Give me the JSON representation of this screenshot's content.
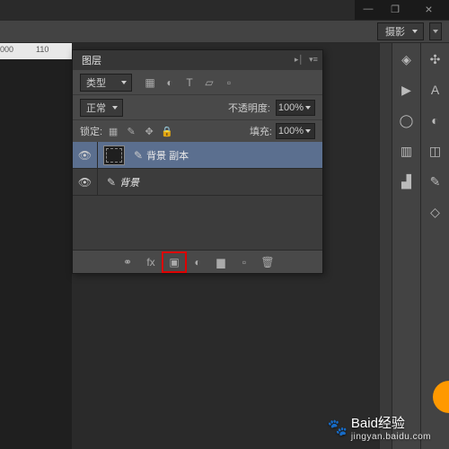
{
  "window": {
    "min": "—",
    "restore": "❐",
    "close": "×"
  },
  "workspace": {
    "selected": "摄影"
  },
  "ruler": {
    "mark1": "000",
    "mark2": "110"
  },
  "panel": {
    "title": "图层",
    "kind_label": "类型",
    "blend_mode": "正常",
    "opacity_label": "不透明度:",
    "opacity_value": "100%",
    "lock_label": "锁定:",
    "fill_label": "填充:",
    "fill_value": "100%",
    "layers": [
      {
        "name": "背景 副本",
        "selected": true
      },
      {
        "name": "背景",
        "selected": false
      }
    ],
    "filter_icons": {
      "img": "▦",
      "adj": "◐",
      "type": "T",
      "shape": "▱",
      "smart": "▫"
    },
    "lock_icons": {
      "trans": "▦",
      "pixel": "✎",
      "pos": "✥",
      "all": "🔒"
    },
    "footer_icons": {
      "link": "⚭",
      "fx": "fx",
      "mask": "▣",
      "adj": "◐",
      "group": "▆",
      "new": "▫",
      "trash": "🗑"
    }
  },
  "dock1": {
    "layers": "◈",
    "play": "▶",
    "circle": "◯",
    "box": "▥",
    "stamp": "▟"
  },
  "dock2": {
    "a": "✣",
    "b": "A",
    "c": "◐",
    "d": "◫",
    "e": "✎",
    "f": "◇"
  },
  "watermark": {
    "brand": "Baid",
    "sub": "经验",
    "url": "jingyan.baidu.com"
  }
}
